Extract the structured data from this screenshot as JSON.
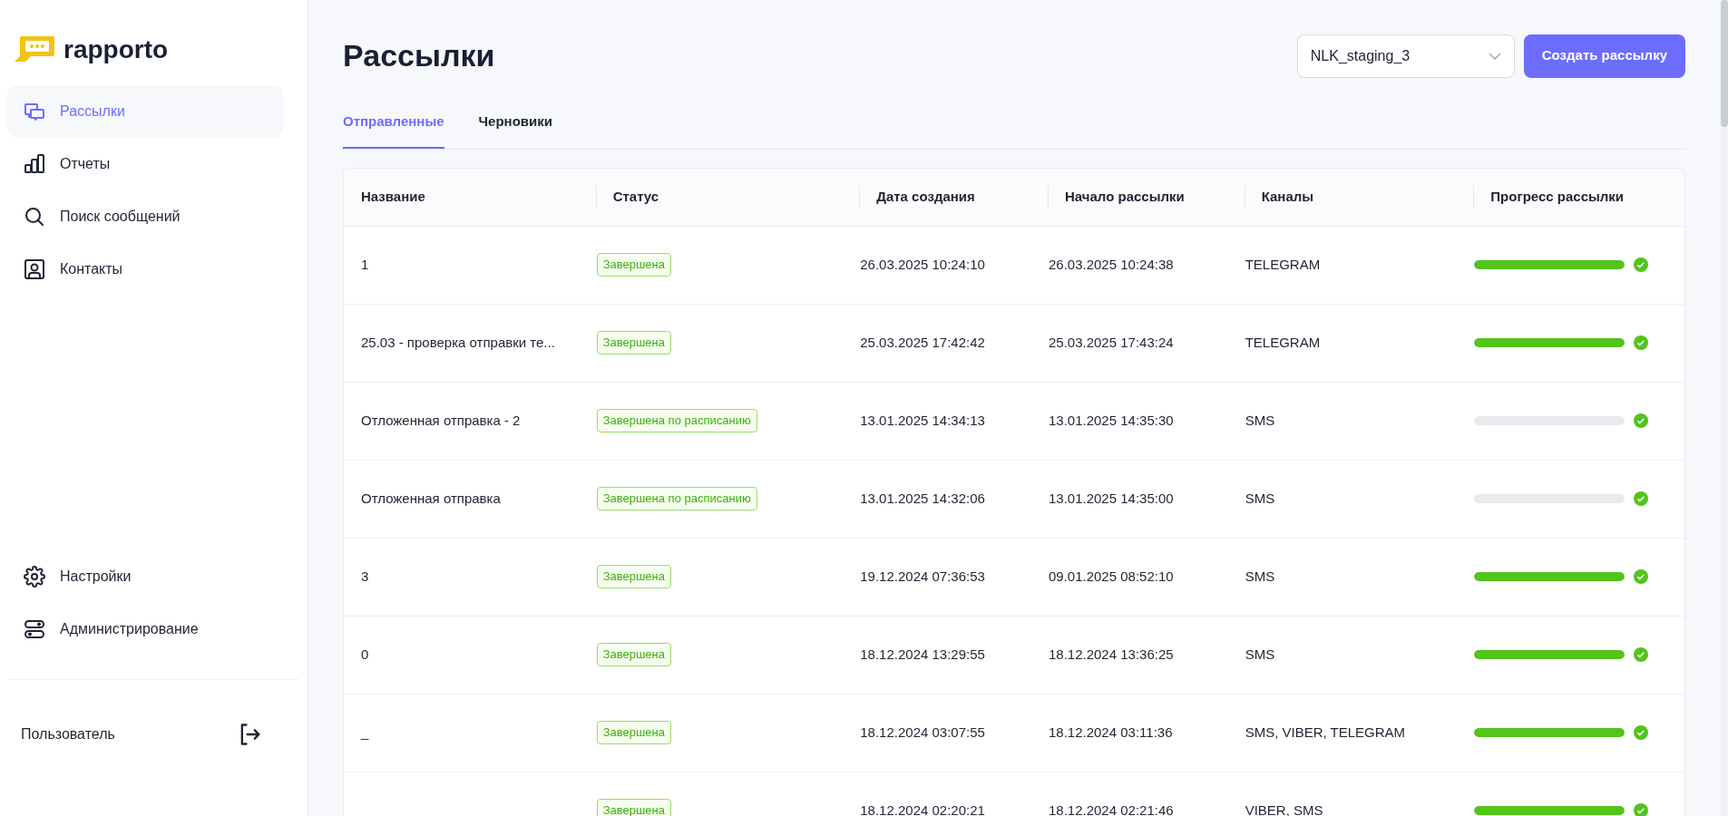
{
  "logo": {
    "text": "rapporto"
  },
  "sidebar": {
    "items": [
      {
        "label": "Рассылки",
        "selected": true
      },
      {
        "label": "Отчеты",
        "selected": false
      },
      {
        "label": "Поиск сообщений",
        "selected": false
      },
      {
        "label": "Контакты",
        "selected": false
      }
    ],
    "bottom_items": [
      {
        "label": "Настройки",
        "selected": false
      },
      {
        "label": "Администрирование",
        "selected": false
      }
    ],
    "user": {
      "name": "Пользователь"
    }
  },
  "page": {
    "title": "Рассылки",
    "project_select": {
      "value": "NLK_staging_3"
    },
    "create_button": "Создать рассылку"
  },
  "tabs": [
    {
      "label": "Отправленные",
      "selected": true
    },
    {
      "label": "Черновики",
      "selected": false
    }
  ],
  "table": {
    "columns": [
      "Название",
      "Статус",
      "Дата создания",
      "Начало рассылки",
      "Каналы",
      "Прогресс рассылки"
    ],
    "rows": [
      {
        "name": "1",
        "status": "Завершена",
        "created": "26.03.2025 10:24:10",
        "started": "26.03.2025 10:24:38",
        "channels": "TELEGRAM",
        "level": 1,
        "done": true
      },
      {
        "name": "25.03 - проверка отправки те...",
        "status": "Завершена",
        "created": "25.03.2025 17:42:42",
        "started": "25.03.2025 17:43:24",
        "channels": "TELEGRAM",
        "level": 1,
        "done": true
      },
      {
        "name": "Отложенная отправка - 2",
        "status": "Завершена по расписанию",
        "created": "13.01.2025 14:34:13",
        "started": "13.01.2025 14:35:30",
        "channels": "SMS",
        "level": 0,
        "done": true
      },
      {
        "name": "Отложенная отправка",
        "status": "Завершена по расписанию",
        "created": "13.01.2025 14:32:06",
        "started": "13.01.2025 14:35:00",
        "channels": "SMS",
        "level": 0,
        "done": true
      },
      {
        "name": "3",
        "status": "Завершена",
        "created": "19.12.2024 07:36:53",
        "started": "09.01.2025 08:52:10",
        "channels": "SMS",
        "level": 1,
        "done": true
      },
      {
        "name": "0",
        "status": "Завершена",
        "created": "18.12.2024 13:29:55",
        "started": "18.12.2024 13:36:25",
        "channels": "SMS",
        "level": 1,
        "done": true
      },
      {
        "name": "_",
        "status": "Завершена",
        "created": "18.12.2024 03:07:55",
        "started": "18.12.2024 03:11:36",
        "channels": "SMS, VIBER, TELEGRAM",
        "level": 1,
        "done": true
      },
      {
        "status": "Завершена",
        "created": "18.12.2024 02:20:21",
        "started": "18.12.2024 02:21:46",
        "channels": "VIBER, SMS",
        "level": 1,
        "done": true
      }
    ]
  }
}
